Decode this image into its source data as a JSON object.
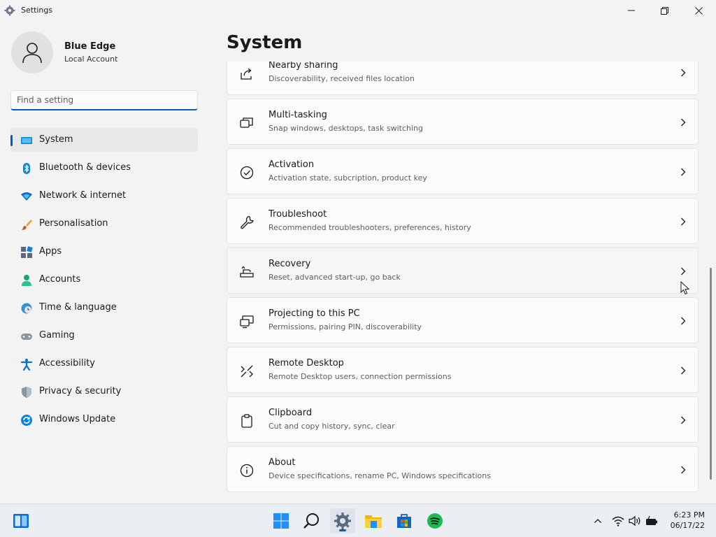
{
  "window": {
    "title": "Settings"
  },
  "user": {
    "name": "Blue Edge",
    "account_type": "Local Account"
  },
  "search": {
    "placeholder": "Find a setting",
    "value": ""
  },
  "sidebar": {
    "items": [
      {
        "label": "System",
        "icon": "system-icon",
        "selected": true
      },
      {
        "label": "Bluetooth & devices",
        "icon": "bluetooth-icon"
      },
      {
        "label": "Network & internet",
        "icon": "network-icon"
      },
      {
        "label": "Personalisation",
        "icon": "brush-icon"
      },
      {
        "label": "Apps",
        "icon": "apps-icon"
      },
      {
        "label": "Accounts",
        "icon": "accounts-icon"
      },
      {
        "label": "Time & language",
        "icon": "globe-clock-icon"
      },
      {
        "label": "Gaming",
        "icon": "gamepad-icon"
      },
      {
        "label": "Accessibility",
        "icon": "accessibility-icon"
      },
      {
        "label": "Privacy & security",
        "icon": "shield-icon"
      },
      {
        "label": "Windows Update",
        "icon": "update-icon"
      }
    ]
  },
  "main": {
    "title": "System",
    "cards": [
      {
        "title": "Nearby sharing",
        "subtitle": "Discoverability, received files location",
        "icon": "share-icon"
      },
      {
        "title": "Multi-tasking",
        "subtitle": "Snap windows, desktops, task switching",
        "icon": "multitasking-icon"
      },
      {
        "title": "Activation",
        "subtitle": "Activation state, subcription, product key",
        "icon": "check-circle-icon"
      },
      {
        "title": "Troubleshoot",
        "subtitle": "Recommended troubleshooters, preferences, history",
        "icon": "wrench-icon"
      },
      {
        "title": "Recovery",
        "subtitle": "Reset, advanced start-up, go back",
        "icon": "recovery-icon"
      },
      {
        "title": "Projecting to this PC",
        "subtitle": "Permissions, pairing PIN, discoverability",
        "icon": "projecting-icon"
      },
      {
        "title": "Remote Desktop",
        "subtitle": "Remote Desktop users, connection permissions",
        "icon": "remote-desktop-icon"
      },
      {
        "title": "Clipboard",
        "subtitle": "Cut and copy history, sync, clear",
        "icon": "clipboard-icon"
      },
      {
        "title": "About",
        "subtitle": "Device specifications, rename PC, Windows specifications",
        "icon": "info-icon"
      }
    ]
  },
  "taskbar": {
    "time": "6:23 PM",
    "date": "06/17/22",
    "apps": [
      "windows-start-icon",
      "search-icon",
      "settings-icon",
      "file-explorer-icon",
      "store-icon",
      "spotify-icon"
    ]
  },
  "colors": {
    "accent": "#005fb8",
    "background": "#f3f3f3",
    "card": "#fbfbfb"
  }
}
